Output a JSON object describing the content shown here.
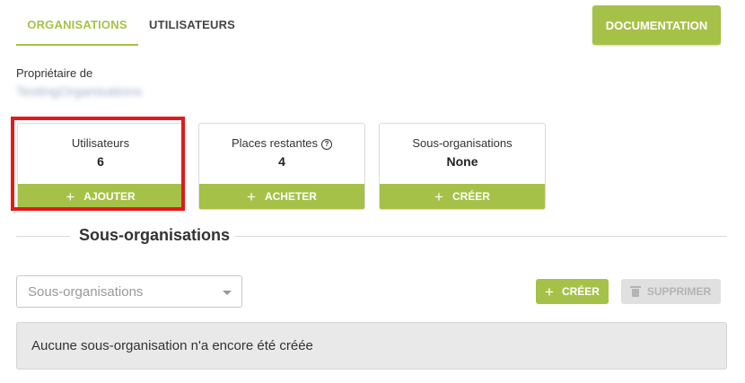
{
  "tabs": [
    {
      "label": "ORGANISATIONS",
      "active": true
    },
    {
      "label": "UTILISATEURS",
      "active": false
    }
  ],
  "documentation_label": "DOCUMENTATION",
  "owner": {
    "label": "Propriétaire de",
    "name": "TestingOrganisations"
  },
  "cards": [
    {
      "label": "Utilisateurs",
      "value": "6",
      "action": "AJOUTER"
    },
    {
      "label": "Places restantes",
      "value": "4",
      "action": "ACHETER"
    },
    {
      "label": "Sous-organisations",
      "value": "None",
      "action": "CRÉER"
    }
  ],
  "section": {
    "title": "Sous-organisations"
  },
  "sub_select": {
    "placeholder": "Sous-organisations"
  },
  "buttons": {
    "create": "CRÉER",
    "delete": "SUPPRIMER"
  },
  "empty_message": "Aucune sous-organisation n'a encore été créée",
  "colors": {
    "accent": "#a6c148",
    "highlight": "#e21a1a",
    "disabled": "#e0e0e0"
  }
}
